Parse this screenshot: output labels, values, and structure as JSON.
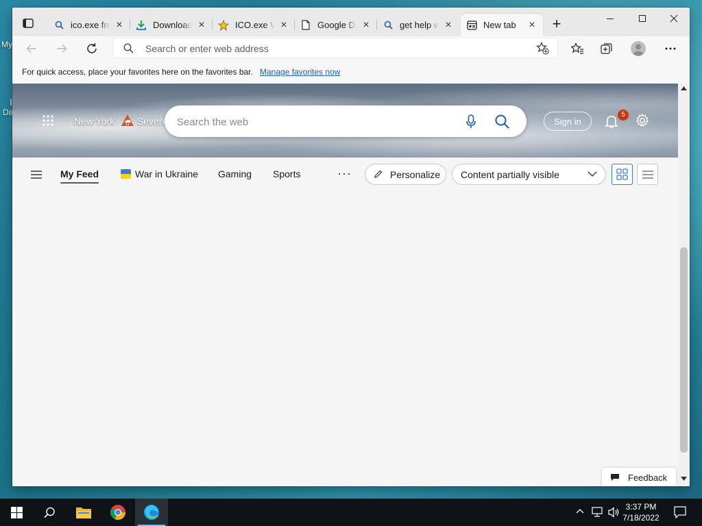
{
  "desktop": {
    "labels": [
      "My",
      "I",
      "Da"
    ]
  },
  "browser": {
    "tabs": [
      {
        "title": "ico.exe free",
        "icon": "search-favicon"
      },
      {
        "title": "Download",
        "icon": "download-favicon"
      },
      {
        "title": "ICO.exe W",
        "icon": "star-favicon"
      },
      {
        "title": "Google Dr",
        "icon": "document-favicon"
      },
      {
        "title": "get help w",
        "icon": "search-favicon"
      },
      {
        "title": "New tab",
        "icon": "newtab-favicon",
        "active": true
      }
    ],
    "new_tab_label": "+",
    "address_placeholder": "Search or enter web address",
    "favorites_bar": {
      "message": "For quick access, place your favorites here on the favorites bar.",
      "link": "Manage favorites now"
    }
  },
  "newtab": {
    "location": "New York",
    "weather": "Severe",
    "search_placeholder": "Search the web",
    "sign_in": "Sign in",
    "notification_count": "5",
    "feed_tabs": [
      "My Feed",
      "War in Ukraine",
      "Gaming",
      "Sports"
    ],
    "more": "···",
    "personalize": "Personalize",
    "content_visibility": "Content partially visible",
    "feedback": "Feedback"
  },
  "taskbar": {
    "time": "3:37 PM",
    "date": "7/18/2022"
  },
  "colors": {
    "accent": "#3e7fd4",
    "badge": "#c4390f",
    "link": "#1a5fb4",
    "taskbar": "#0f1318"
  }
}
